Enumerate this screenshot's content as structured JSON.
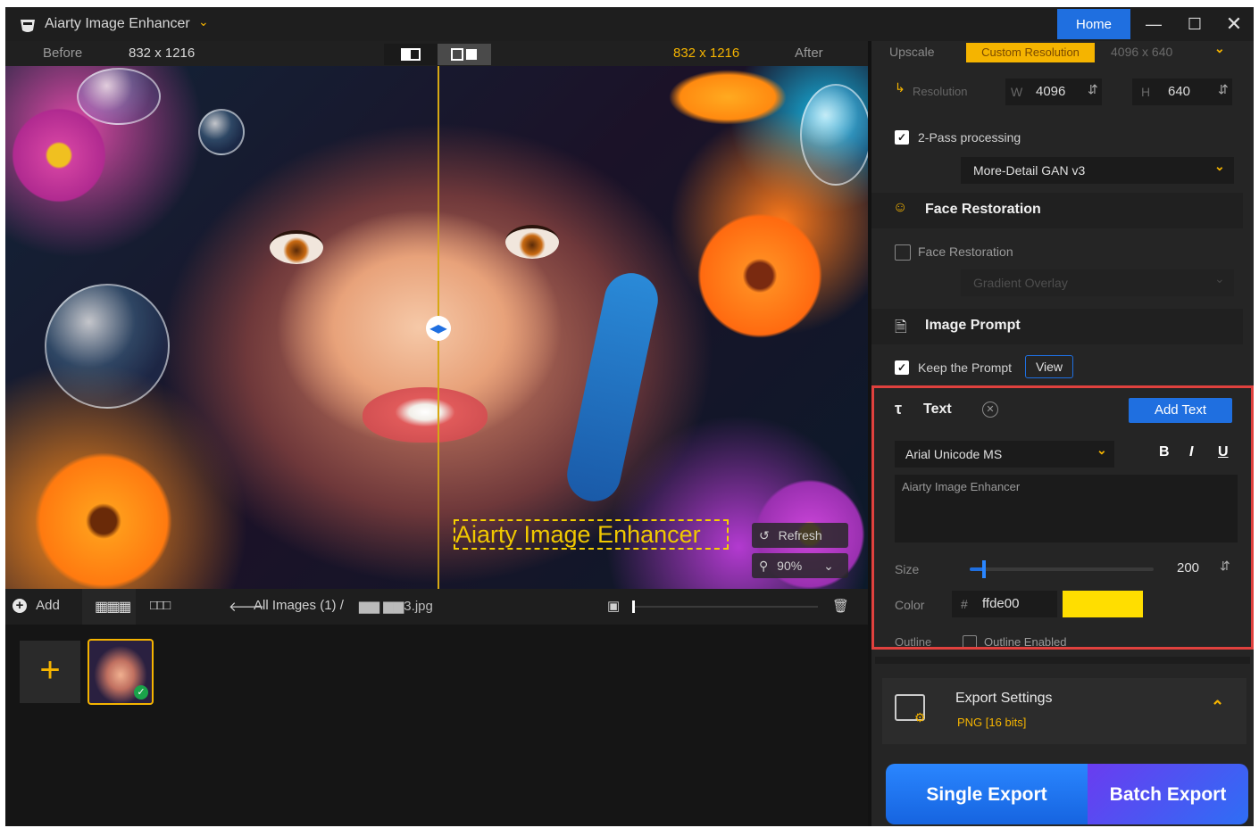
{
  "app": {
    "title": "Aiarty Image Enhancer",
    "home_tab": "Home"
  },
  "compare": {
    "before_label": "Before",
    "before_size": "832 x 1216",
    "after_size": "832 x 1216",
    "after_label": "After"
  },
  "canvas": {
    "overlay_text": "Aiarty Image Enhancer",
    "refresh_label": "Refresh",
    "zoom": "90%"
  },
  "image_toolbar": {
    "add_label": "Add",
    "breadcrumb": "All Images (1)  /",
    "filename": "▆▆ ▆▆3.jpg"
  },
  "upscale": {
    "label": "Upscale",
    "mode": "Custom Resolution",
    "output": "4096 x 640",
    "resolution_label": "Resolution",
    "w_label": "W",
    "w_value": "4096",
    "h_label": "H",
    "h_value": "640"
  },
  "two_pass": {
    "label": "2-Pass processing",
    "checked": true,
    "model": "More-Detail GAN  v3"
  },
  "face_restoration": {
    "title": "Face Restoration",
    "checkbox_label": "Face Restoration",
    "model": "Gradient Overlay"
  },
  "image_prompt": {
    "title": "Image Prompt",
    "keep_label": "Keep the Prompt",
    "view_label": "View"
  },
  "text_panel": {
    "title": "Text",
    "add_button": "Add Text",
    "font": "Arial Unicode MS",
    "bold": "B",
    "italic": "I",
    "underline": "U",
    "content": "Aiarty Image Enhancer",
    "size_label": "Size",
    "size_value": "200",
    "size_fraction": 0.08,
    "color_label": "Color",
    "hash": "#",
    "color_hex": "ffde00",
    "color_swatch": "#ffde00",
    "outline_label": "Outline",
    "outline_checkbox": "Outline Enabled"
  },
  "export": {
    "title": "Export Settings",
    "format": "PNG  [16 bits]",
    "single": "Single Export",
    "batch": "Batch Export"
  },
  "colors": {
    "accent": "#f5b400",
    "primary": "#1f6fe0",
    "highlight": "#e0413e"
  }
}
